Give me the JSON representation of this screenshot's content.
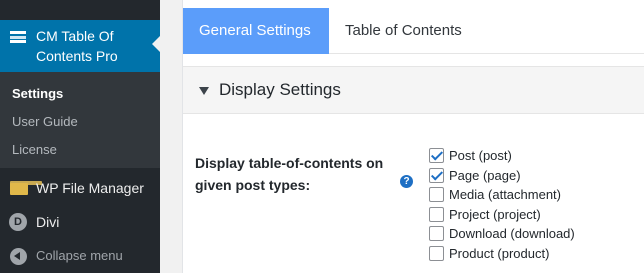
{
  "sidebar": {
    "active_menu": {
      "title": "CM Table Of Contents Pro",
      "icon": "table-icon"
    },
    "submenu": [
      {
        "label": "Settings",
        "current": true
      },
      {
        "label": "User Guide",
        "current": false
      },
      {
        "label": "License",
        "current": false
      }
    ],
    "menu_items": [
      {
        "label": "WP File Manager",
        "icon": "folder-icon"
      },
      {
        "label": "Divi",
        "icon": "divi-icon",
        "icon_letter": "D"
      },
      {
        "label": "Collapse menu",
        "icon": "collapse-icon"
      }
    ],
    "colors": {
      "background": "#23282d",
      "active": "#0073aa"
    }
  },
  "tabs": [
    {
      "label": "General Settings",
      "active": true
    },
    {
      "label": "Table of Contents",
      "active": false
    }
  ],
  "section": {
    "title": "Display Settings",
    "icon": "triangle-down-icon"
  },
  "field": {
    "label": "Display table-of-contents on given post types:",
    "help_icon": "question-mark-icon",
    "help_glyph": "?",
    "options": [
      {
        "label": "Post (post)",
        "checked": true
      },
      {
        "label": "Page (page)",
        "checked": true
      },
      {
        "label": "Media (attachment)",
        "checked": false
      },
      {
        "label": "Project (project)",
        "checked": false
      },
      {
        "label": "Download (download)",
        "checked": false
      },
      {
        "label": "Product (product)",
        "checked": false
      }
    ]
  },
  "colors": {
    "tab_active": "#5b9dfa",
    "checkmark": "#1e6fc4"
  }
}
